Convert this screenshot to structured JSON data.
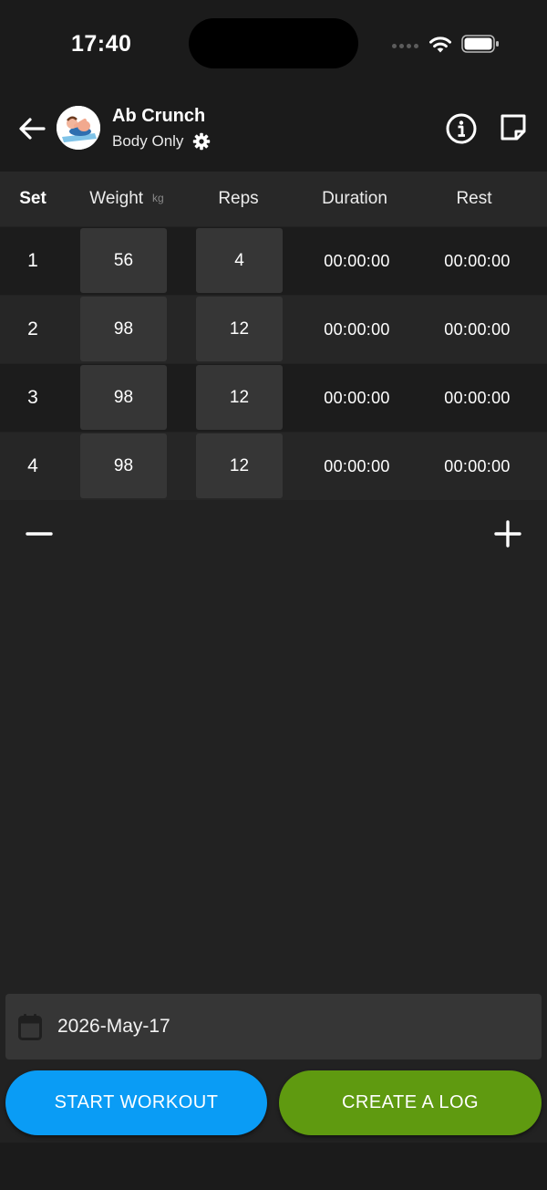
{
  "status_bar": {
    "time": "17:40",
    "icons": [
      "signal-icon",
      "wifi-icon",
      "battery-icon"
    ]
  },
  "header": {
    "title": "Ab Crunch",
    "equipment": "Body Only",
    "icons": [
      "back-arrow-icon",
      "exercise-avatar",
      "gear-icon",
      "info-icon",
      "note-icon"
    ]
  },
  "table": {
    "columns": {
      "set": "Set",
      "weight": "Weight",
      "weight_unit": "kg",
      "reps": "Reps",
      "duration": "Duration",
      "rest": "Rest"
    },
    "rows": [
      {
        "set": "1",
        "weight": "56",
        "reps": "4",
        "duration": "00:00:00",
        "rest": "00:00:00"
      },
      {
        "set": "2",
        "weight": "98",
        "reps": "12",
        "duration": "00:00:00",
        "rest": "00:00:00"
      },
      {
        "set": "3",
        "weight": "98",
        "reps": "12",
        "duration": "00:00:00",
        "rest": "00:00:00"
      },
      {
        "set": "4",
        "weight": "98",
        "reps": "12",
        "duration": "00:00:00",
        "rest": "00:00:00"
      }
    ]
  },
  "controls": {
    "remove_icon": "minus-icon",
    "add_icon": "plus-icon"
  },
  "date": {
    "icon": "calendar-icon",
    "value": "2026-May-17"
  },
  "actions": {
    "start_label": "START WORKOUT",
    "log_label": "CREATE A LOG"
  },
  "colors": {
    "background": "#222222",
    "start_button": "#0a9cf5",
    "log_button": "#5f9a10"
  }
}
